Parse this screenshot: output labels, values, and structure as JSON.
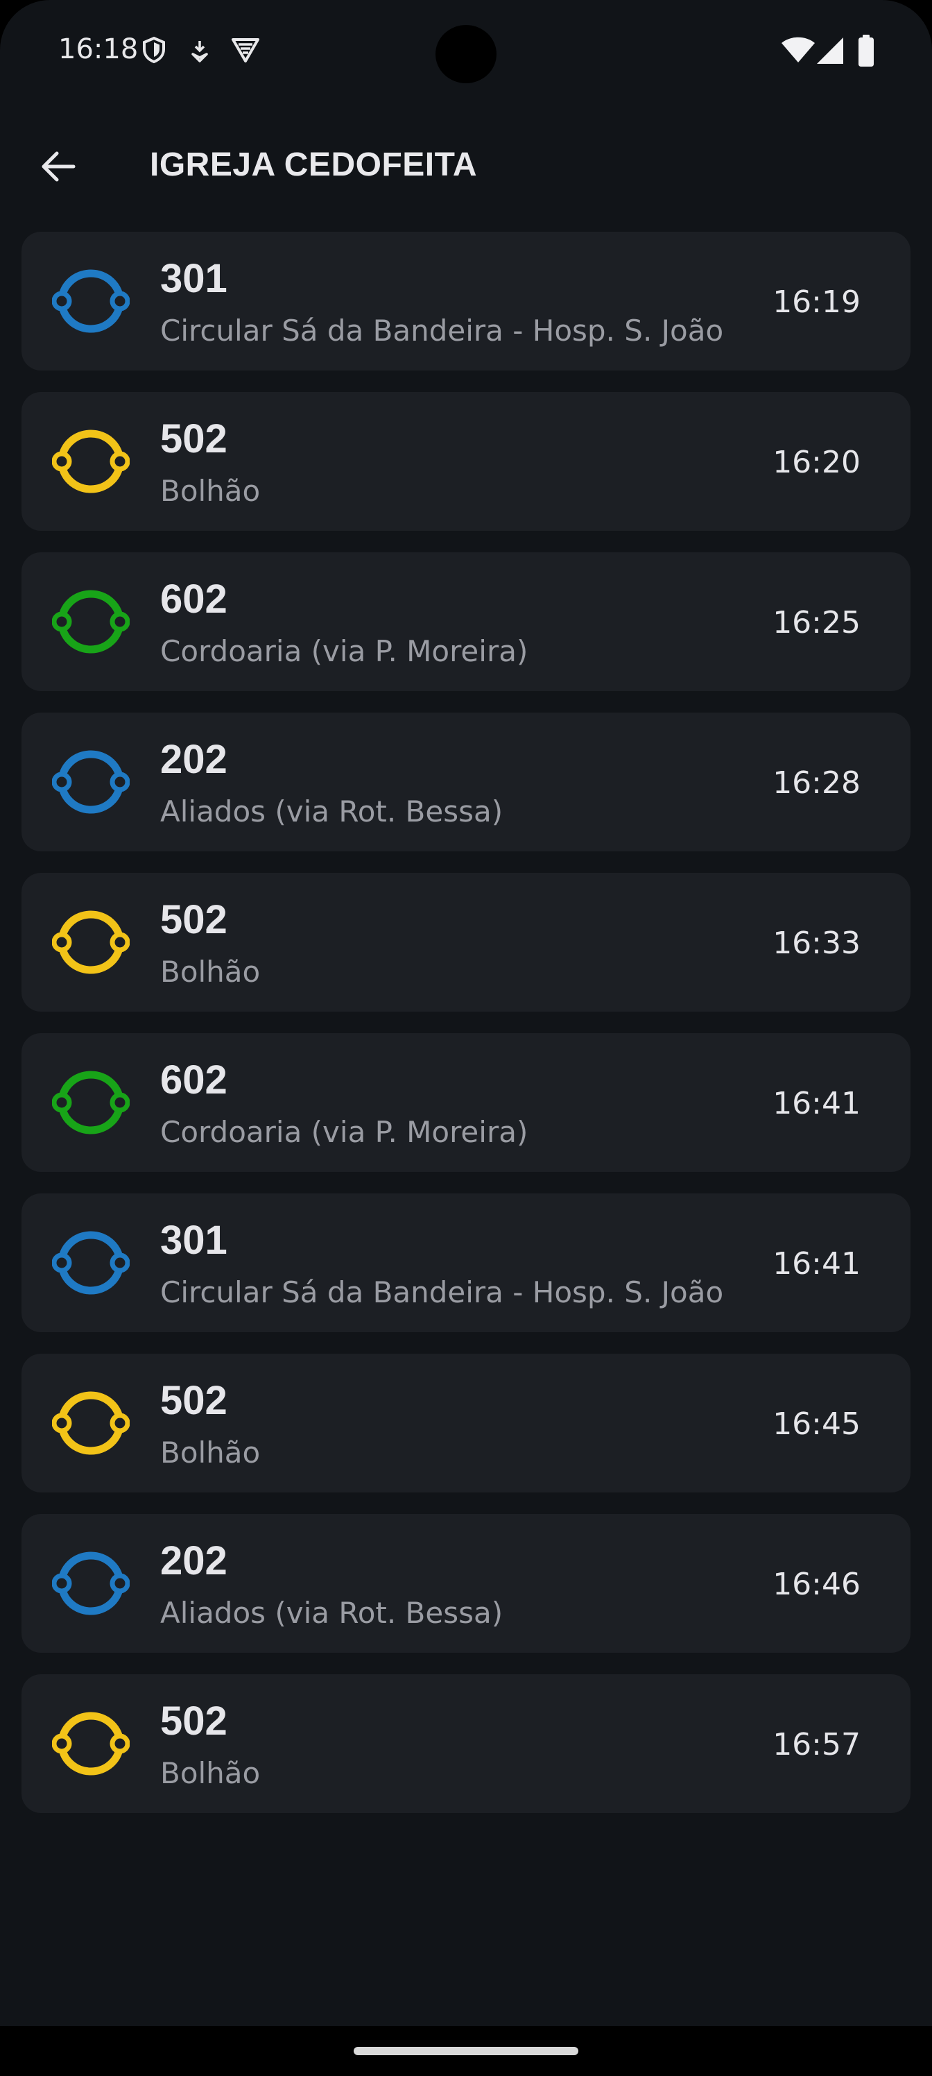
{
  "status_bar": {
    "time": "16:18",
    "left_icons": [
      "shield-icon",
      "download-icon",
      "vpn-icon"
    ],
    "right_icons": [
      "wifi-icon",
      "signal-icon",
      "battery-icon"
    ]
  },
  "app_bar": {
    "back_icon": "arrow-back-icon",
    "title": "IGREJA CEDOFEITA"
  },
  "colors": {
    "blue": "#1f7ac4",
    "yellow": "#f2c318",
    "green": "#18a418"
  },
  "departures": [
    {
      "line": "301",
      "destination": "Circular Sá da Bandeira - Hosp. S. João",
      "time": "16:19",
      "color": "#1f7ac4"
    },
    {
      "line": "502",
      "destination": "Bolhão",
      "time": "16:20",
      "color": "#f2c318"
    },
    {
      "line": "602",
      "destination": "Cordoaria (via P. Moreira)",
      "time": "16:25",
      "color": "#18a418"
    },
    {
      "line": "202",
      "destination": "Aliados (via Rot. Bessa)",
      "time": "16:28",
      "color": "#1f7ac4"
    },
    {
      "line": "502",
      "destination": "Bolhão",
      "time": "16:33",
      "color": "#f2c318"
    },
    {
      "line": "602",
      "destination": "Cordoaria (via P. Moreira)",
      "time": "16:41",
      "color": "#18a418"
    },
    {
      "line": "301",
      "destination": "Circular Sá da Bandeira - Hosp. S. João",
      "time": "16:41",
      "color": "#1f7ac4"
    },
    {
      "line": "502",
      "destination": "Bolhão",
      "time": "16:45",
      "color": "#f2c318"
    },
    {
      "line": "202",
      "destination": "Aliados (via Rot. Bessa)",
      "time": "16:46",
      "color": "#1f7ac4"
    },
    {
      "line": "502",
      "destination": "Bolhão",
      "time": "16:57",
      "color": "#f2c318"
    }
  ]
}
